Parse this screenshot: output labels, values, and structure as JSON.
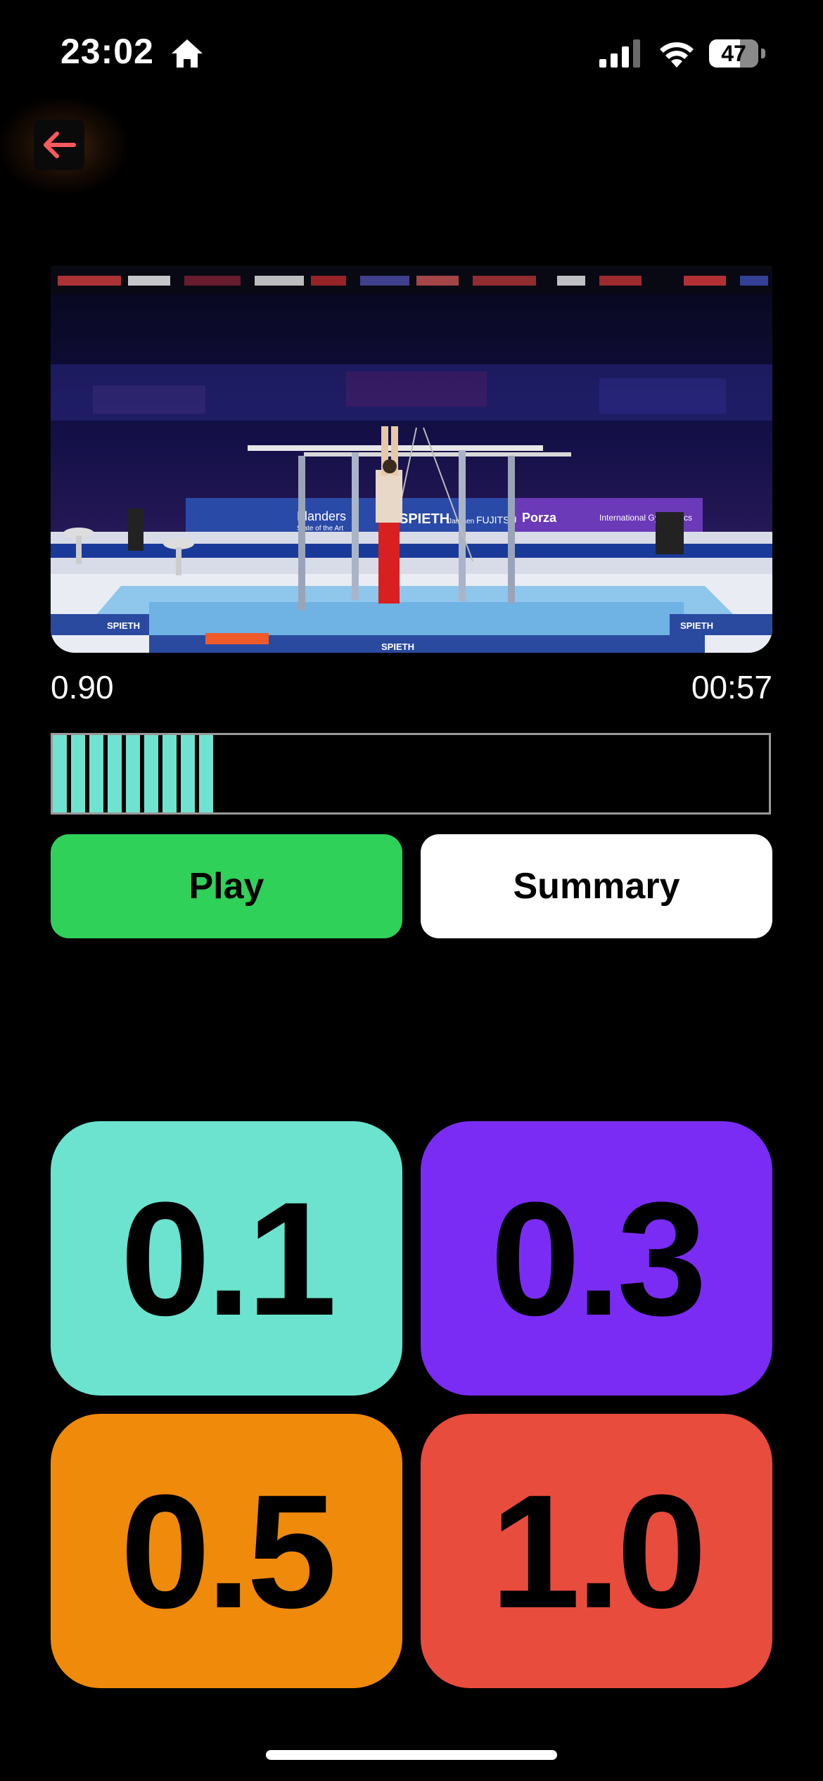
{
  "status_bar": {
    "time": "23:02",
    "battery_level": "47",
    "icons": [
      "home-icon",
      "signal-icon",
      "wifi-icon",
      "battery-icon"
    ]
  },
  "nav": {
    "back_icon": "arrow-left-icon",
    "accent_color": "#ff5a5f"
  },
  "video": {
    "banner_texts": [
      "Flanders",
      "State of the Art",
      "SPIETH",
      "Janssen",
      "FUJITSU",
      "Porza",
      "International Gymnastics"
    ],
    "mat_brand": "SPIETH"
  },
  "playback": {
    "left_value": "0.90",
    "time": "00:57"
  },
  "progress": {
    "fill_fraction": 0.23
  },
  "actions": {
    "play_label": "Play",
    "summary_label": "Summary"
  },
  "deductions": [
    {
      "label": "0.1",
      "color": "#6be3cf"
    },
    {
      "label": "0.3",
      "color": "#7a2cf5"
    },
    {
      "label": "0.5",
      "color": "#ef8a0a"
    },
    {
      "label": "1.0",
      "color": "#e84c3d"
    }
  ]
}
